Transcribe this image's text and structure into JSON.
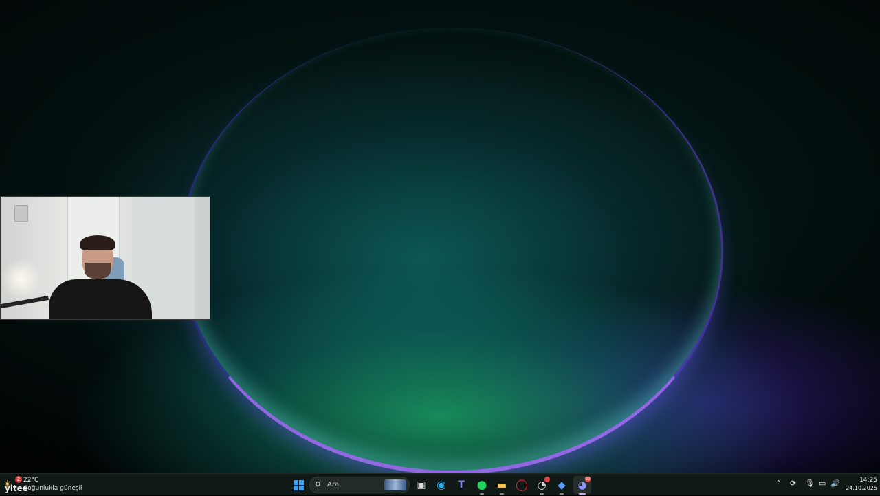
{
  "desktop": {
    "wallpaper": "windows-11-bloom-dark",
    "accent_colors": [
      "#1fdc8c",
      "#0f7f7f",
      "#7a46ff",
      "#b07dff"
    ]
  },
  "webcam": {
    "visible": true
  },
  "taskbar": {
    "weather": {
      "temperature": "22°C",
      "description": "Çoğunlukla güneşli",
      "badge_count": "2",
      "icon": "sun-cloud-icon"
    },
    "watermark": "yitee",
    "search": {
      "placeholder": "Ara",
      "icon": "search-icon"
    },
    "apps": [
      {
        "name": "start",
        "icon": "windows-logo-icon"
      },
      {
        "name": "task-view",
        "icon": "task-view-icon"
      },
      {
        "name": "edge",
        "icon": "edge-icon",
        "color": "#2fa8e0"
      },
      {
        "name": "teams",
        "icon": "teams-icon",
        "color": "#7b83eb"
      },
      {
        "name": "spotify",
        "icon": "spotify-icon",
        "color": "#1ed760"
      },
      {
        "name": "file-explorer",
        "icon": "folder-icon",
        "color": "#f2c14e"
      },
      {
        "name": "opera-gx",
        "icon": "opera-icon",
        "color": "#e0243a"
      },
      {
        "name": "app-clock",
        "icon": "clock-app-icon",
        "color": "#d9d9d9"
      },
      {
        "name": "app-diamond",
        "icon": "diamond-app-icon",
        "color": "#5aa0ff"
      },
      {
        "name": "discord",
        "icon": "discord-icon",
        "color": "#5865f2",
        "badge": "99"
      }
    ],
    "tray": {
      "icons": [
        "chevron-up-icon",
        "sync-icon",
        "microphone-icon",
        "display-icon",
        "volume-icon"
      ]
    },
    "clock": {
      "time": "14:25",
      "date": "24.10.2025"
    }
  }
}
